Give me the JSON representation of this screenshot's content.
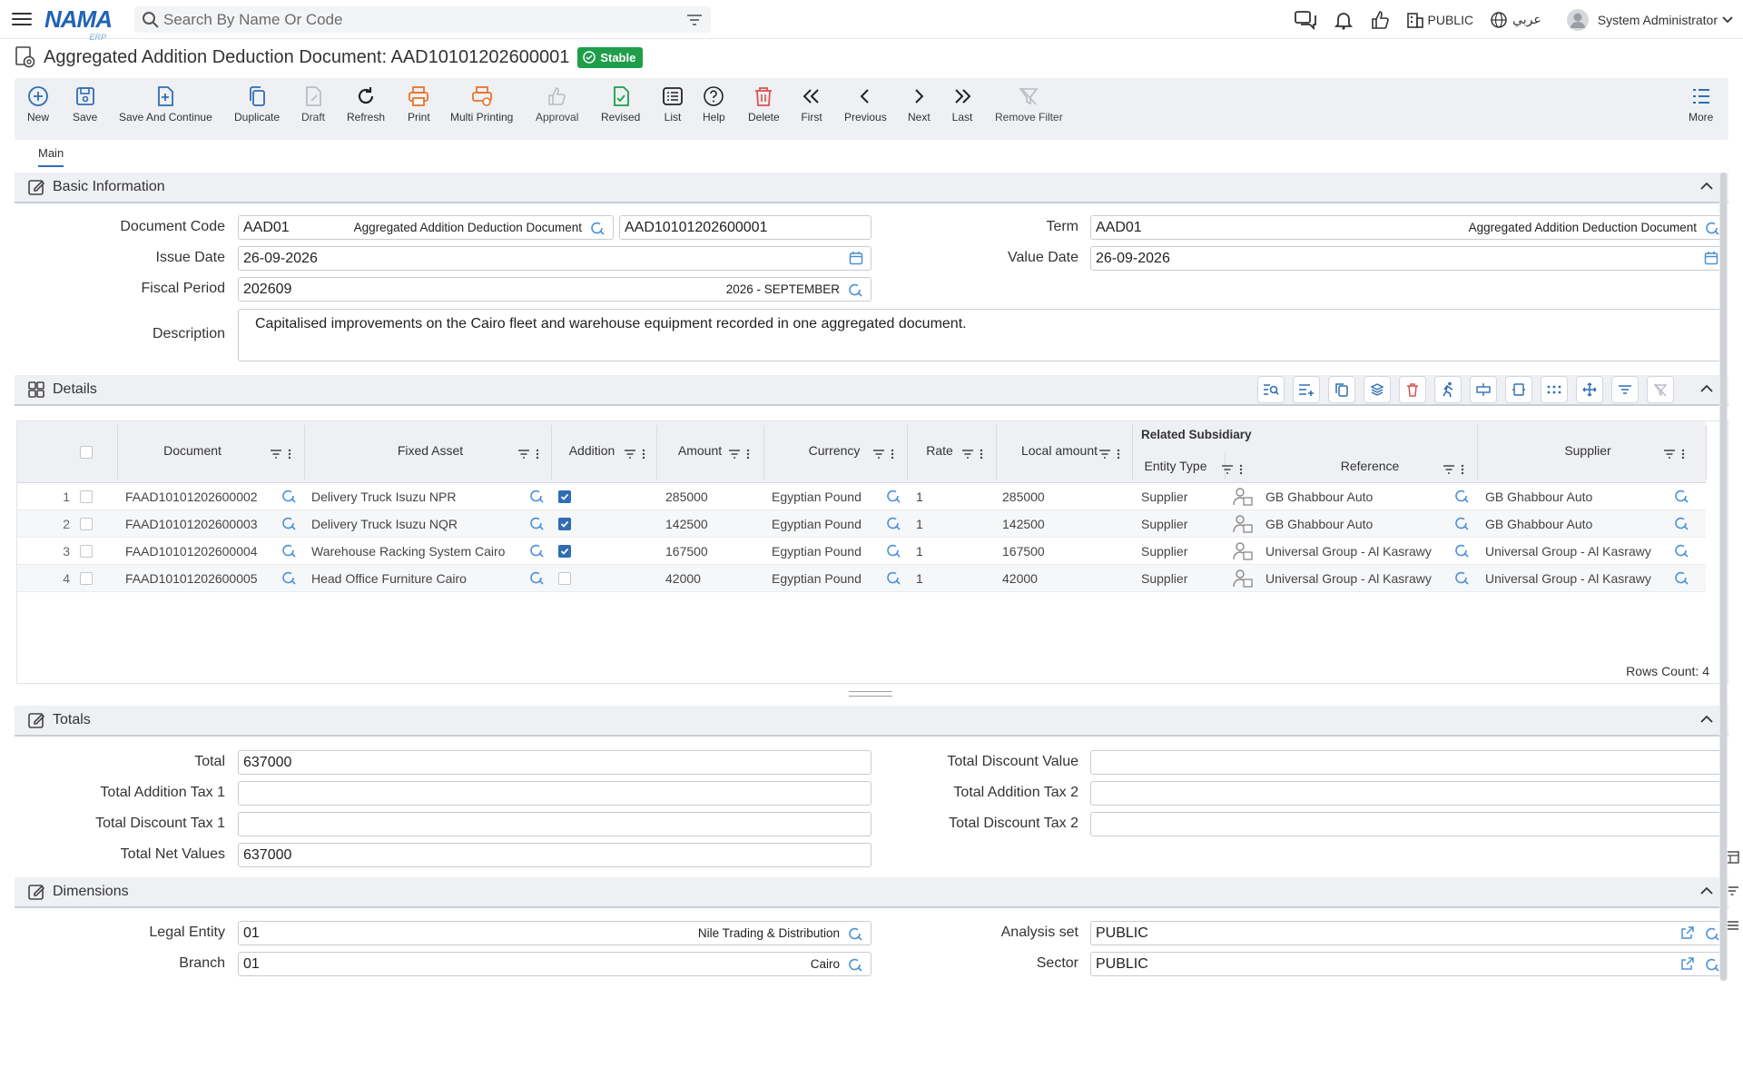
{
  "app": {
    "logo": "NAMA",
    "logo_sub": "ERP"
  },
  "search": {
    "placeholder": "Search By Name Or Code"
  },
  "topbar": {
    "public_label": "PUBLIC",
    "language_label": "عربي",
    "user_name": "System Administrator"
  },
  "page": {
    "title": "Aggregated Addition Deduction Document: AAD10101202600001",
    "status_badge": "Stable"
  },
  "toolbar": {
    "new": "New",
    "save": "Save",
    "save_continue": "Save And Continue",
    "duplicate": "Duplicate",
    "draft": "Draft",
    "refresh": "Refresh",
    "print": "Print",
    "multi_printing": "Multi Printing",
    "approval": "Approval",
    "revised": "Revised",
    "list": "List",
    "help": "Help",
    "delete": "Delete",
    "first": "First",
    "previous": "Previous",
    "next": "Next",
    "last": "Last",
    "remove_filter": "Remove Filter",
    "more": "More"
  },
  "tabs": {
    "main": "Main"
  },
  "basic": {
    "heading": "Basic Information",
    "document_code_label": "Document Code",
    "document_code_value": "AAD01",
    "document_code_name": "Aggregated Addition Deduction Document",
    "document_number": "AAD10101202600001",
    "term_label": "Term",
    "term_value": "AAD01",
    "term_name": "Aggregated Addition Deduction Document",
    "issue_date_label": "Issue Date",
    "issue_date_value": "26-09-2026",
    "value_date_label": "Value Date",
    "value_date_value": "26-09-2026",
    "fiscal_period_label": "Fiscal Period",
    "fiscal_period_value": "202609",
    "fiscal_period_name": "2026 - SEPTEMBER",
    "description_label": "Description",
    "description_value": "Capitalised improvements on the Cairo fleet and warehouse equipment recorded in one aggregated document."
  },
  "details": {
    "heading": "Details",
    "columns": {
      "document": "Document",
      "fixed_asset": "Fixed Asset",
      "addition": "Addition",
      "amount": "Amount",
      "currency": "Currency",
      "rate": "Rate",
      "local_amount": "Local amount",
      "related_subsidiary": "Related Subsidiary",
      "entity_type": "Entity Type",
      "reference": "Reference",
      "supplier": "Supplier"
    },
    "rows": [
      {
        "n": "1",
        "document": "FAAD10101202600002",
        "fixed_asset": "Delivery Truck Isuzu NPR",
        "addition": true,
        "amount": "285000",
        "currency": "Egyptian Pound",
        "rate": "1",
        "local_amount": "285000",
        "entity_type": "Supplier",
        "reference": "GB Ghabbour Auto",
        "supplier": "GB Ghabbour Auto"
      },
      {
        "n": "2",
        "document": "FAAD10101202600003",
        "fixed_asset": "Delivery Truck Isuzu NQR",
        "addition": true,
        "amount": "142500",
        "currency": "Egyptian Pound",
        "rate": "1",
        "local_amount": "142500",
        "entity_type": "Supplier",
        "reference": "GB Ghabbour Auto",
        "supplier": "GB Ghabbour Auto"
      },
      {
        "n": "3",
        "document": "FAAD10101202600004",
        "fixed_asset": "Warehouse Racking System Cairo",
        "addition": true,
        "amount": "167500",
        "currency": "Egyptian Pound",
        "rate": "1",
        "local_amount": "167500",
        "entity_type": "Supplier",
        "reference": "Universal Group - Al Kasrawy",
        "supplier": "Universal Group - Al Kasrawy"
      },
      {
        "n": "4",
        "document": "FAAD10101202600005",
        "fixed_asset": "Head Office Furniture Cairo",
        "addition": false,
        "amount": "42000",
        "currency": "Egyptian Pound",
        "rate": "1",
        "local_amount": "42000",
        "entity_type": "Supplier",
        "reference": "Universal Group - Al Kasrawy",
        "supplier": "Universal Group - Al Kasrawy"
      }
    ],
    "rows_count": "Rows Count: 4"
  },
  "totals": {
    "heading": "Totals",
    "total_label": "Total",
    "total_value": "637000",
    "total_discount_value_label": "Total Discount Value",
    "total_discount_value": "",
    "total_addition_tax1_label": "Total Addition Tax 1",
    "total_addition_tax1": "",
    "total_addition_tax2_label": "Total Addition Tax 2",
    "total_addition_tax2": "",
    "total_discount_tax1_label": "Total Discount Tax 1",
    "total_discount_tax1": "",
    "total_discount_tax2_label": "Total Discount Tax 2",
    "total_discount_tax2": "",
    "total_net_label": "Total Net Values",
    "total_net_value": "637000"
  },
  "dimensions": {
    "heading": "Dimensions",
    "legal_entity_label": "Legal Entity",
    "legal_entity_value": "01",
    "legal_entity_name": "Nile Trading & Distribution",
    "analysis_set_label": "Analysis set",
    "analysis_set_value": "PUBLIC",
    "branch_label": "Branch",
    "branch_value": "01",
    "branch_name": "Cairo",
    "sector_label": "Sector",
    "sector_value": "PUBLIC"
  },
  "colors": {
    "accent": "#2f6db5",
    "badge": "#1e9e4a",
    "toolbar_bg": "#eef0f3",
    "danger": "#d9534f",
    "print": "#e8742c"
  }
}
